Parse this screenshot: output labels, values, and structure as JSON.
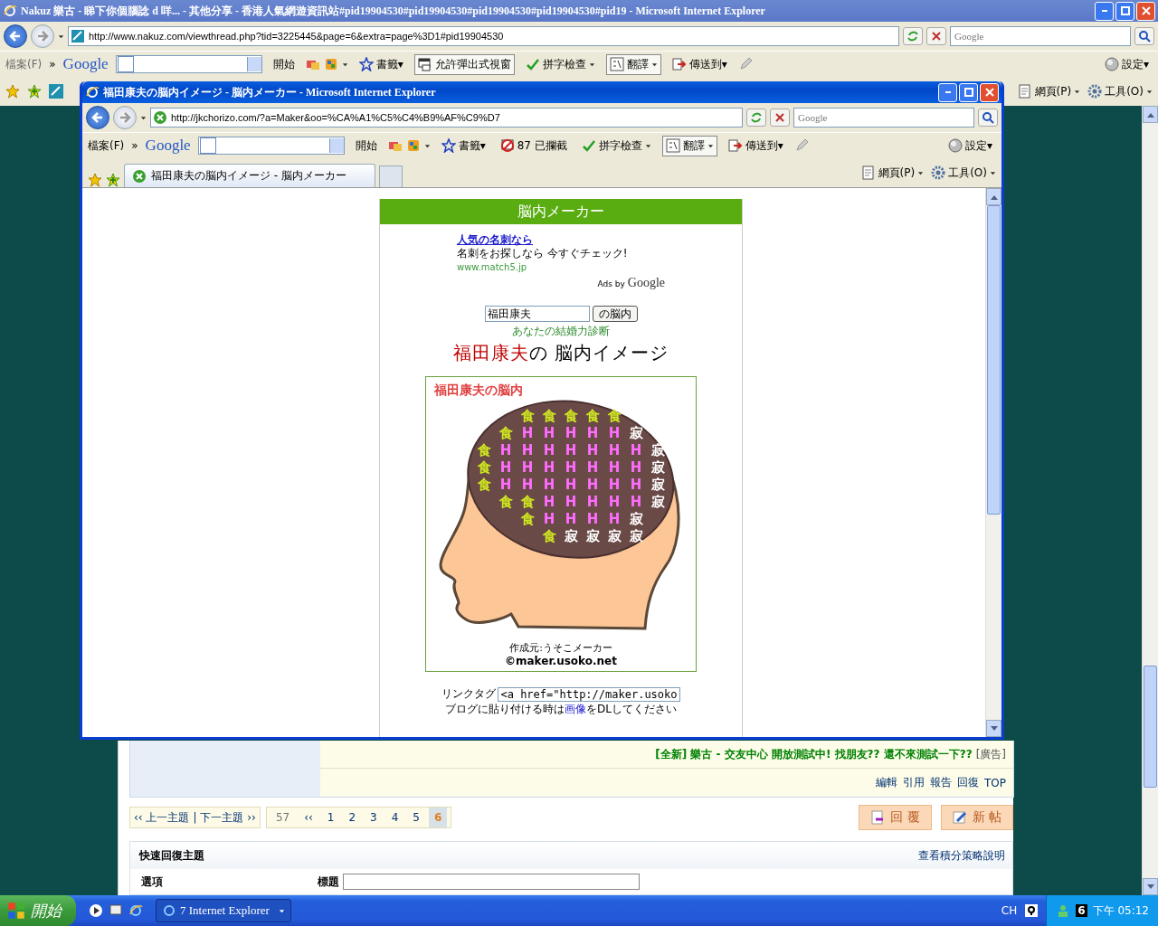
{
  "main_window": {
    "title": "Nakuz 樂古 - 睇下你個腦諗 d 咩... - 其他分享 - 香港人氣網遊資訊站#pid19904530#pid19904530#pid19904530#pid19904530#pid19 - Microsoft Internet Explorer",
    "active": false,
    "address": "http://www.nakuz.com/viewthread.php?tid=3225445&page=6&extra=page%3D1#pid19904530",
    "search_placeholder": "Google",
    "toolbar": [
      {
        "kind": "menu",
        "label": "檔案(F)"
      },
      {
        "kind": "chevron",
        "label": "»"
      },
      {
        "kind": "logo",
        "label": "Google"
      },
      {
        "kind": "combo"
      },
      {
        "kind": "start",
        "label": "開始"
      },
      {
        "kind": "tools"
      },
      {
        "kind": "bookmarks",
        "label": "書籤▾"
      },
      {
        "kind": "popups",
        "label": "允許彈出式視窗"
      },
      {
        "kind": "spellcheck",
        "label": "拼字檢查"
      },
      {
        "kind": "translate",
        "label": "翻譯"
      },
      {
        "kind": "send",
        "label": "傳送到▾"
      },
      {
        "kind": "pencil"
      },
      {
        "kind": "spacer"
      },
      {
        "kind": "settings",
        "label": "設定▾"
      }
    ],
    "command_bar": [
      {
        "kind": "page",
        "label": "網頁(P)"
      },
      {
        "kind": "tools",
        "label": "工具(O)"
      }
    ]
  },
  "popup_window": {
    "title": "福田康夫の脳内イメージ - 脳内メーカー - Microsoft Internet Explorer",
    "active": true,
    "address": "http://jkchorizo.com/?a=Maker&oo=%CA%A1%C5%C4%B9%AF%C9%D7",
    "search_placeholder": "Google",
    "toolbar": [
      {
        "kind": "menu",
        "label": "檔案(F)"
      },
      {
        "kind": "chevron",
        "label": "»"
      },
      {
        "kind": "logo",
        "label": "Google"
      },
      {
        "kind": "combo"
      },
      {
        "kind": "start",
        "label": "開始"
      },
      {
        "kind": "tools"
      },
      {
        "kind": "bookmarks",
        "label": "書籤▾"
      },
      {
        "kind": "blocked",
        "label": "87 已攔截"
      },
      {
        "kind": "spellcheck",
        "label": "拼字檢查"
      },
      {
        "kind": "translate",
        "label": "翻譯"
      },
      {
        "kind": "send",
        "label": "傳送到▾"
      },
      {
        "kind": "pencil"
      },
      {
        "kind": "spacer"
      },
      {
        "kind": "settings",
        "label": "設定▾"
      }
    ],
    "tab": {
      "label": "福田康夫の脳内イメージ - 脳内メーカー"
    },
    "command_bar": [
      {
        "kind": "page",
        "label": "網頁(P)"
      },
      {
        "kind": "tools",
        "label": "工具(O)"
      }
    ]
  },
  "brain_page": {
    "header": "脳内メーカー",
    "ad": {
      "title": "人気の名刺なら",
      "text": "名刺をお探しなら 今すぐチェック!",
      "url": "www.match5.jp",
      "ads_by": "Ads by",
      "google": "Google"
    },
    "name_input": "福田康夫",
    "submit": "の脳内",
    "link": "あなたの結婚力診断",
    "result_name": "福田康夫",
    "result_suffix": "の 脳内イメージ",
    "card": {
      "title": "福田康夫の脳内",
      "rows": [
        [
          {
            "kind": "empty"
          },
          {
            "kind": "empty"
          },
          {
            "text": "食",
            "kind": "food"
          },
          {
            "text": "食",
            "kind": "food"
          },
          {
            "text": "食",
            "kind": "food"
          },
          {
            "text": "食",
            "kind": "food"
          },
          {
            "text": "食",
            "kind": "food"
          },
          {
            "kind": "empty"
          },
          {
            "kind": "empty"
          }
        ],
        [
          {
            "kind": "empty"
          },
          {
            "text": "食",
            "kind": "food"
          },
          {
            "text": "H",
            "kind": "h"
          },
          {
            "text": "H",
            "kind": "h"
          },
          {
            "text": "H",
            "kind": "h"
          },
          {
            "text": "H",
            "kind": "h"
          },
          {
            "text": "H",
            "kind": "h"
          },
          {
            "text": "寂",
            "kind": "lonely"
          },
          {
            "kind": "empty"
          }
        ],
        [
          {
            "text": "食",
            "kind": "food"
          },
          {
            "text": "H",
            "kind": "h"
          },
          {
            "text": "H",
            "kind": "h"
          },
          {
            "text": "H",
            "kind": "h"
          },
          {
            "text": "H",
            "kind": "h"
          },
          {
            "text": "H",
            "kind": "h"
          },
          {
            "text": "H",
            "kind": "h"
          },
          {
            "text": "H",
            "kind": "h"
          },
          {
            "text": "寂",
            "kind": "lonely"
          }
        ],
        [
          {
            "text": "食",
            "kind": "food"
          },
          {
            "text": "H",
            "kind": "h"
          },
          {
            "text": "H",
            "kind": "h"
          },
          {
            "text": "H",
            "kind": "h"
          },
          {
            "text": "H",
            "kind": "h"
          },
          {
            "text": "H",
            "kind": "h"
          },
          {
            "text": "H",
            "kind": "h"
          },
          {
            "text": "H",
            "kind": "h"
          },
          {
            "text": "寂",
            "kind": "lonely"
          }
        ],
        [
          {
            "text": "食",
            "kind": "food"
          },
          {
            "text": "H",
            "kind": "h"
          },
          {
            "text": "H",
            "kind": "h"
          },
          {
            "text": "H",
            "kind": "h"
          },
          {
            "text": "H",
            "kind": "h"
          },
          {
            "text": "H",
            "kind": "h"
          },
          {
            "text": "H",
            "kind": "h"
          },
          {
            "text": "H",
            "kind": "h"
          },
          {
            "text": "寂",
            "kind": "lonely"
          }
        ],
        [
          {
            "kind": "empty"
          },
          {
            "text": "食",
            "kind": "food"
          },
          {
            "text": "食",
            "kind": "food"
          },
          {
            "text": "H",
            "kind": "h"
          },
          {
            "text": "H",
            "kind": "h"
          },
          {
            "text": "H",
            "kind": "h"
          },
          {
            "text": "H",
            "kind": "h"
          },
          {
            "text": "H",
            "kind": "h"
          },
          {
            "text": "寂",
            "kind": "lonely"
          }
        ],
        [
          {
            "kind": "empty"
          },
          {
            "kind": "empty"
          },
          {
            "text": "食",
            "kind": "food"
          },
          {
            "text": "H",
            "kind": "h"
          },
          {
            "text": "H",
            "kind": "h"
          },
          {
            "text": "H",
            "kind": "h"
          },
          {
            "text": "H",
            "kind": "h"
          },
          {
            "text": "寂",
            "kind": "lonely"
          },
          {
            "kind": "empty"
          }
        ],
        [
          {
            "kind": "empty"
          },
          {
            "kind": "empty"
          },
          {
            "kind": "empty"
          },
          {
            "text": "食",
            "kind": "food"
          },
          {
            "text": "寂",
            "kind": "lonely"
          },
          {
            "text": "寂",
            "kind": "lonely"
          },
          {
            "text": "寂",
            "kind": "lonely"
          },
          {
            "text": "寂",
            "kind": "lonely"
          },
          {
            "kind": "empty"
          }
        ]
      ],
      "credit": "作成元:うそこメーカー",
      "copyright": "©maker.usoko.net"
    },
    "link_tag_label": "リンクタグ",
    "link_tag_value": "<a href=\"http://maker.usoko",
    "note_before": "ブログに貼り付ける時は",
    "note_link": "画像",
    "note_after": "をDLしてください"
  },
  "forum": {
    "ad_tag": "[全新]",
    "ad_text": "樂古 - 交友中心 開放測試中! 找朋友?? 還不來測試一下??",
    "ad_label": "[廣告]",
    "actions": [
      "編輯",
      "引用",
      "報告",
      "回復",
      "TOP"
    ],
    "prev": "‹‹ 上一主題",
    "separator": "|",
    "next": "下一主題 ››",
    "pages": [
      {
        "label": "57",
        "selected": false
      },
      {
        "label": "‹‹",
        "selected": false
      },
      {
        "label": "1",
        "selected": false
      },
      {
        "label": "2",
        "selected": false
      },
      {
        "label": "3",
        "selected": false
      },
      {
        "label": "4",
        "selected": false
      },
      {
        "label": "5",
        "selected": false
      },
      {
        "label": "6",
        "selected": true
      }
    ],
    "buttons": [
      {
        "kind": "reply",
        "label": "回 覆"
      },
      {
        "kind": "new",
        "label": "新 帖"
      }
    ],
    "quick_reply": {
      "title": "快速回復主題",
      "link": "查看積分策略說明",
      "option_label": "選項",
      "subject_label": "標題"
    }
  },
  "taskbar": {
    "start": "開始",
    "task": "7 Internet Explorer",
    "lang": "CH",
    "badge": "6",
    "clock": "下午 05:12"
  }
}
